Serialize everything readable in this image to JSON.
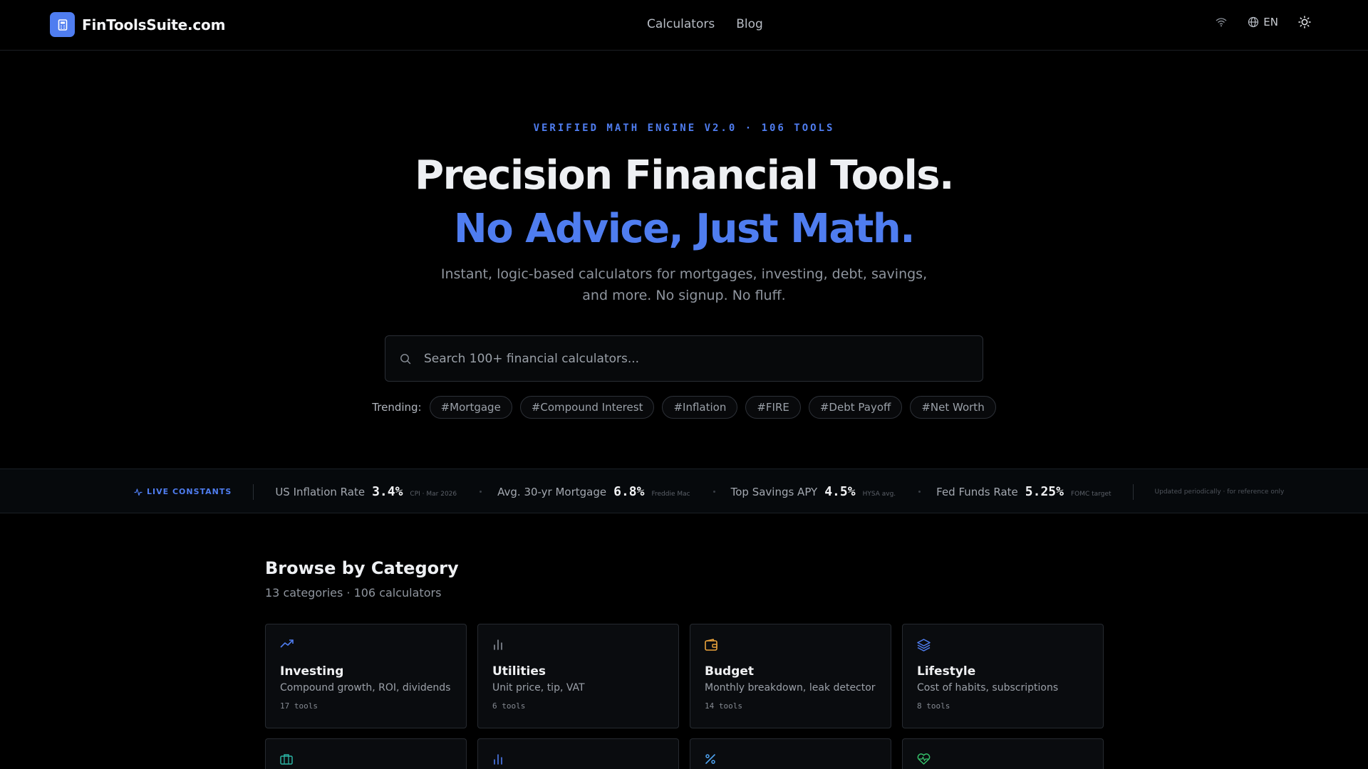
{
  "header": {
    "brand": "FinToolsSuite.com",
    "nav": [
      "Calculators",
      "Blog"
    ],
    "language": "EN"
  },
  "hero": {
    "eyebrow": "VERIFIED MATH ENGINE V2.0 · 106 TOOLS",
    "title_line1": "Precision Financial Tools.",
    "title_line2": "No Advice, Just Math.",
    "subtitle_line1": "Instant, logic-based calculators for mortgages, investing, debt, savings,",
    "subtitle_line2": "and more. No signup. No fluff."
  },
  "search": {
    "placeholder": "Search 100+ financial calculators...",
    "value": ""
  },
  "trending": {
    "label": "Trending:",
    "tags": [
      "#Mortgage",
      "#Compound Interest",
      "#Inflation",
      "#FIRE",
      "#Debt Payoff",
      "#Net Worth"
    ]
  },
  "constants": {
    "badge": "LIVE CONSTANTS",
    "items": [
      {
        "label": "US Inflation Rate",
        "value": "3.4%",
        "source": "CPI · Mar 2026"
      },
      {
        "label": "Avg. 30-yr Mortgage",
        "value": "6.8%",
        "source": "Freddie Mac"
      },
      {
        "label": "Top Savings APY",
        "value": "4.5%",
        "source": "HYSA avg."
      },
      {
        "label": "Fed Funds Rate",
        "value": "5.25%",
        "source": "FOMC target"
      }
    ],
    "updated": "Updated periodically · for reference only"
  },
  "categories": {
    "title": "Browse by Category",
    "subtitle": "13 categories · 106 calculators",
    "items": [
      {
        "name": "Investing",
        "desc": "Compound growth, ROI, dividends",
        "count": "17 tools",
        "icon": "trending-up-icon",
        "color": "#4f7df0"
      },
      {
        "name": "Utilities",
        "desc": "Unit price, tip, VAT",
        "count": "6 tools",
        "icon": "bar-chart-icon",
        "color": "#8a9099"
      },
      {
        "name": "Budget",
        "desc": "Monthly breakdown, leak detector",
        "count": "14 tools",
        "icon": "wallet-icon",
        "color": "#e9a23b"
      },
      {
        "name": "Lifestyle",
        "desc": "Cost of habits, subscriptions",
        "count": "8 tools",
        "icon": "layers-icon",
        "color": "#4f7df0"
      }
    ],
    "row2_icons": [
      {
        "icon": "briefcase-icon",
        "color": "#2bb3a3"
      },
      {
        "icon": "bar-chart-icon",
        "color": "#4f7df0"
      },
      {
        "icon": "percent-icon",
        "color": "#4fa3f0"
      },
      {
        "icon": "heart-pulse-icon",
        "color": "#36c26b"
      }
    ]
  },
  "colors": {
    "accent": "#4f7df0",
    "background": "#000000"
  }
}
